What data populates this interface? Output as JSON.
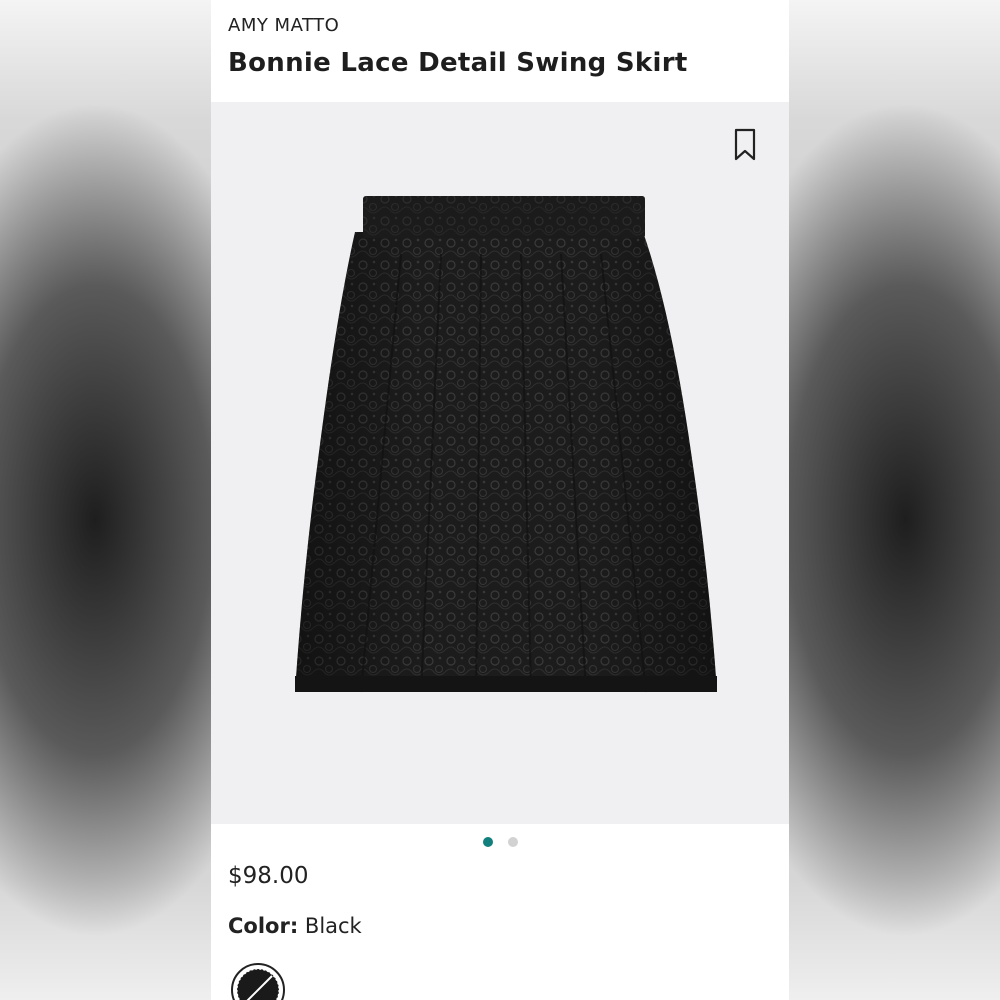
{
  "product": {
    "brand": "AMY MATTO",
    "name": "Bonnie Lace Detail Swing Skirt",
    "price": "$98.00",
    "color_label": "Color:",
    "color_value": "Black",
    "image_count": 2,
    "active_image_index": 0
  },
  "colors": {
    "accent": "#11807d",
    "skirt": "#1b1b1b",
    "image_bg": "#f0f0f2"
  },
  "icons": {
    "bookmark": "bookmark-icon",
    "swatch": "color-swatch-black"
  }
}
